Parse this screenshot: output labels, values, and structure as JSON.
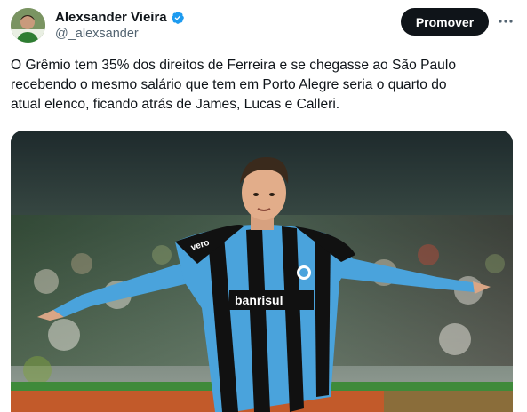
{
  "author": {
    "name": "Alexsander Vieira",
    "handle": "@_alexsander",
    "verified": true,
    "avatar_icon": "profile-photo"
  },
  "actions": {
    "promote_label": "Promover",
    "more_icon": "more-horizontal-icon"
  },
  "tweet": {
    "text": "O Grêmio tem 35% dos direitos de Ferreira e se chegasse ao São Paulo\nrecebendo o mesmo salário que tem em Porto Alegre seria o quarto do\natual elenco, ficando atrás de James, Lucas e Calleri."
  },
  "media": {
    "shirt_sponsor_main": "banrisul",
    "shirt_sponsor_sleeve": "vero"
  },
  "colors": {
    "verified_blue": "#1d9bf0",
    "button_bg": "#0f1419",
    "handle_gray": "#536471",
    "shirt_blue": "#4aa3dc"
  }
}
